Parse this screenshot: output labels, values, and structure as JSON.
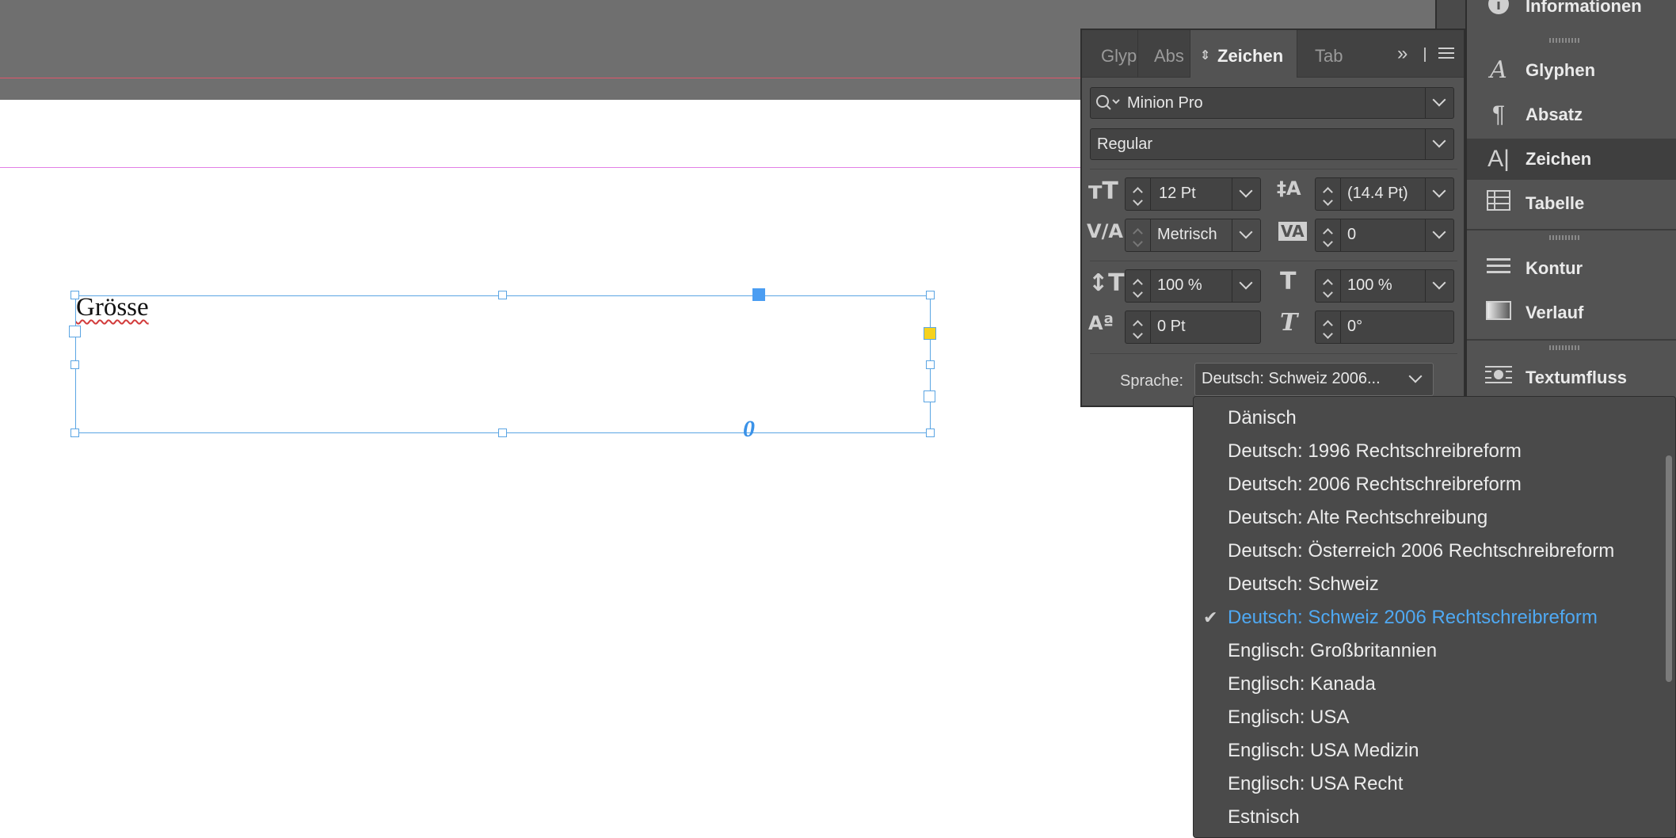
{
  "document": {
    "frame_text": "Grösse"
  },
  "char_panel": {
    "tabs": [
      "Glyp",
      "Abs",
      "Zeichen",
      "Tab"
    ],
    "font_family": "Minion Pro",
    "font_style": "Regular",
    "font_size": "12 Pt",
    "leading": "(14.4 Pt)",
    "kerning": "Metrisch",
    "tracking": "0",
    "vertical_scale": "100 %",
    "horizontal_scale": "100 %",
    "baseline_shift": "0 Pt",
    "skew": "0°",
    "language_label": "Sprache:",
    "language_value": "Deutsch: Schweiz 2006..."
  },
  "dock": {
    "items": [
      {
        "label": "Informationen",
        "icon": "info-icon"
      },
      {
        "label": "Glyphen",
        "icon": "glyphs-icon"
      },
      {
        "label": "Absatz",
        "icon": "paragraph-icon"
      },
      {
        "label": "Zeichen",
        "icon": "character-icon"
      },
      {
        "label": "Tabelle",
        "icon": "table-icon"
      },
      {
        "label": "Kontur",
        "icon": "stroke-icon"
      },
      {
        "label": "Verlauf",
        "icon": "gradient-icon"
      },
      {
        "label": "Textumfluss",
        "icon": "text-wrap-icon"
      }
    ]
  },
  "language_dropdown": {
    "selected": "Deutsch: Schweiz 2006 Rechtschreibreform",
    "options": [
      "Dänisch",
      "Deutsch: 1996 Rechtschreibreform",
      "Deutsch: 2006 Rechtschreibreform",
      "Deutsch: Alte Rechtschreibung",
      "Deutsch: Österreich 2006 Rechtschreibreform",
      "Deutsch: Schweiz",
      "Deutsch: Schweiz 2006 Rechtschreibreform",
      "Englisch: Großbritannien",
      "Englisch: Kanada",
      "Englisch: USA",
      "Englisch: USA Medizin",
      "Englisch: USA Recht",
      "Estnisch"
    ]
  },
  "colors": {
    "panel_bg": "#535353",
    "selection_blue": "#4fa9f3",
    "frame_blue": "#5ba5e3",
    "bleed_red": "#e0566a",
    "margin_magenta": "#e27fe6"
  }
}
